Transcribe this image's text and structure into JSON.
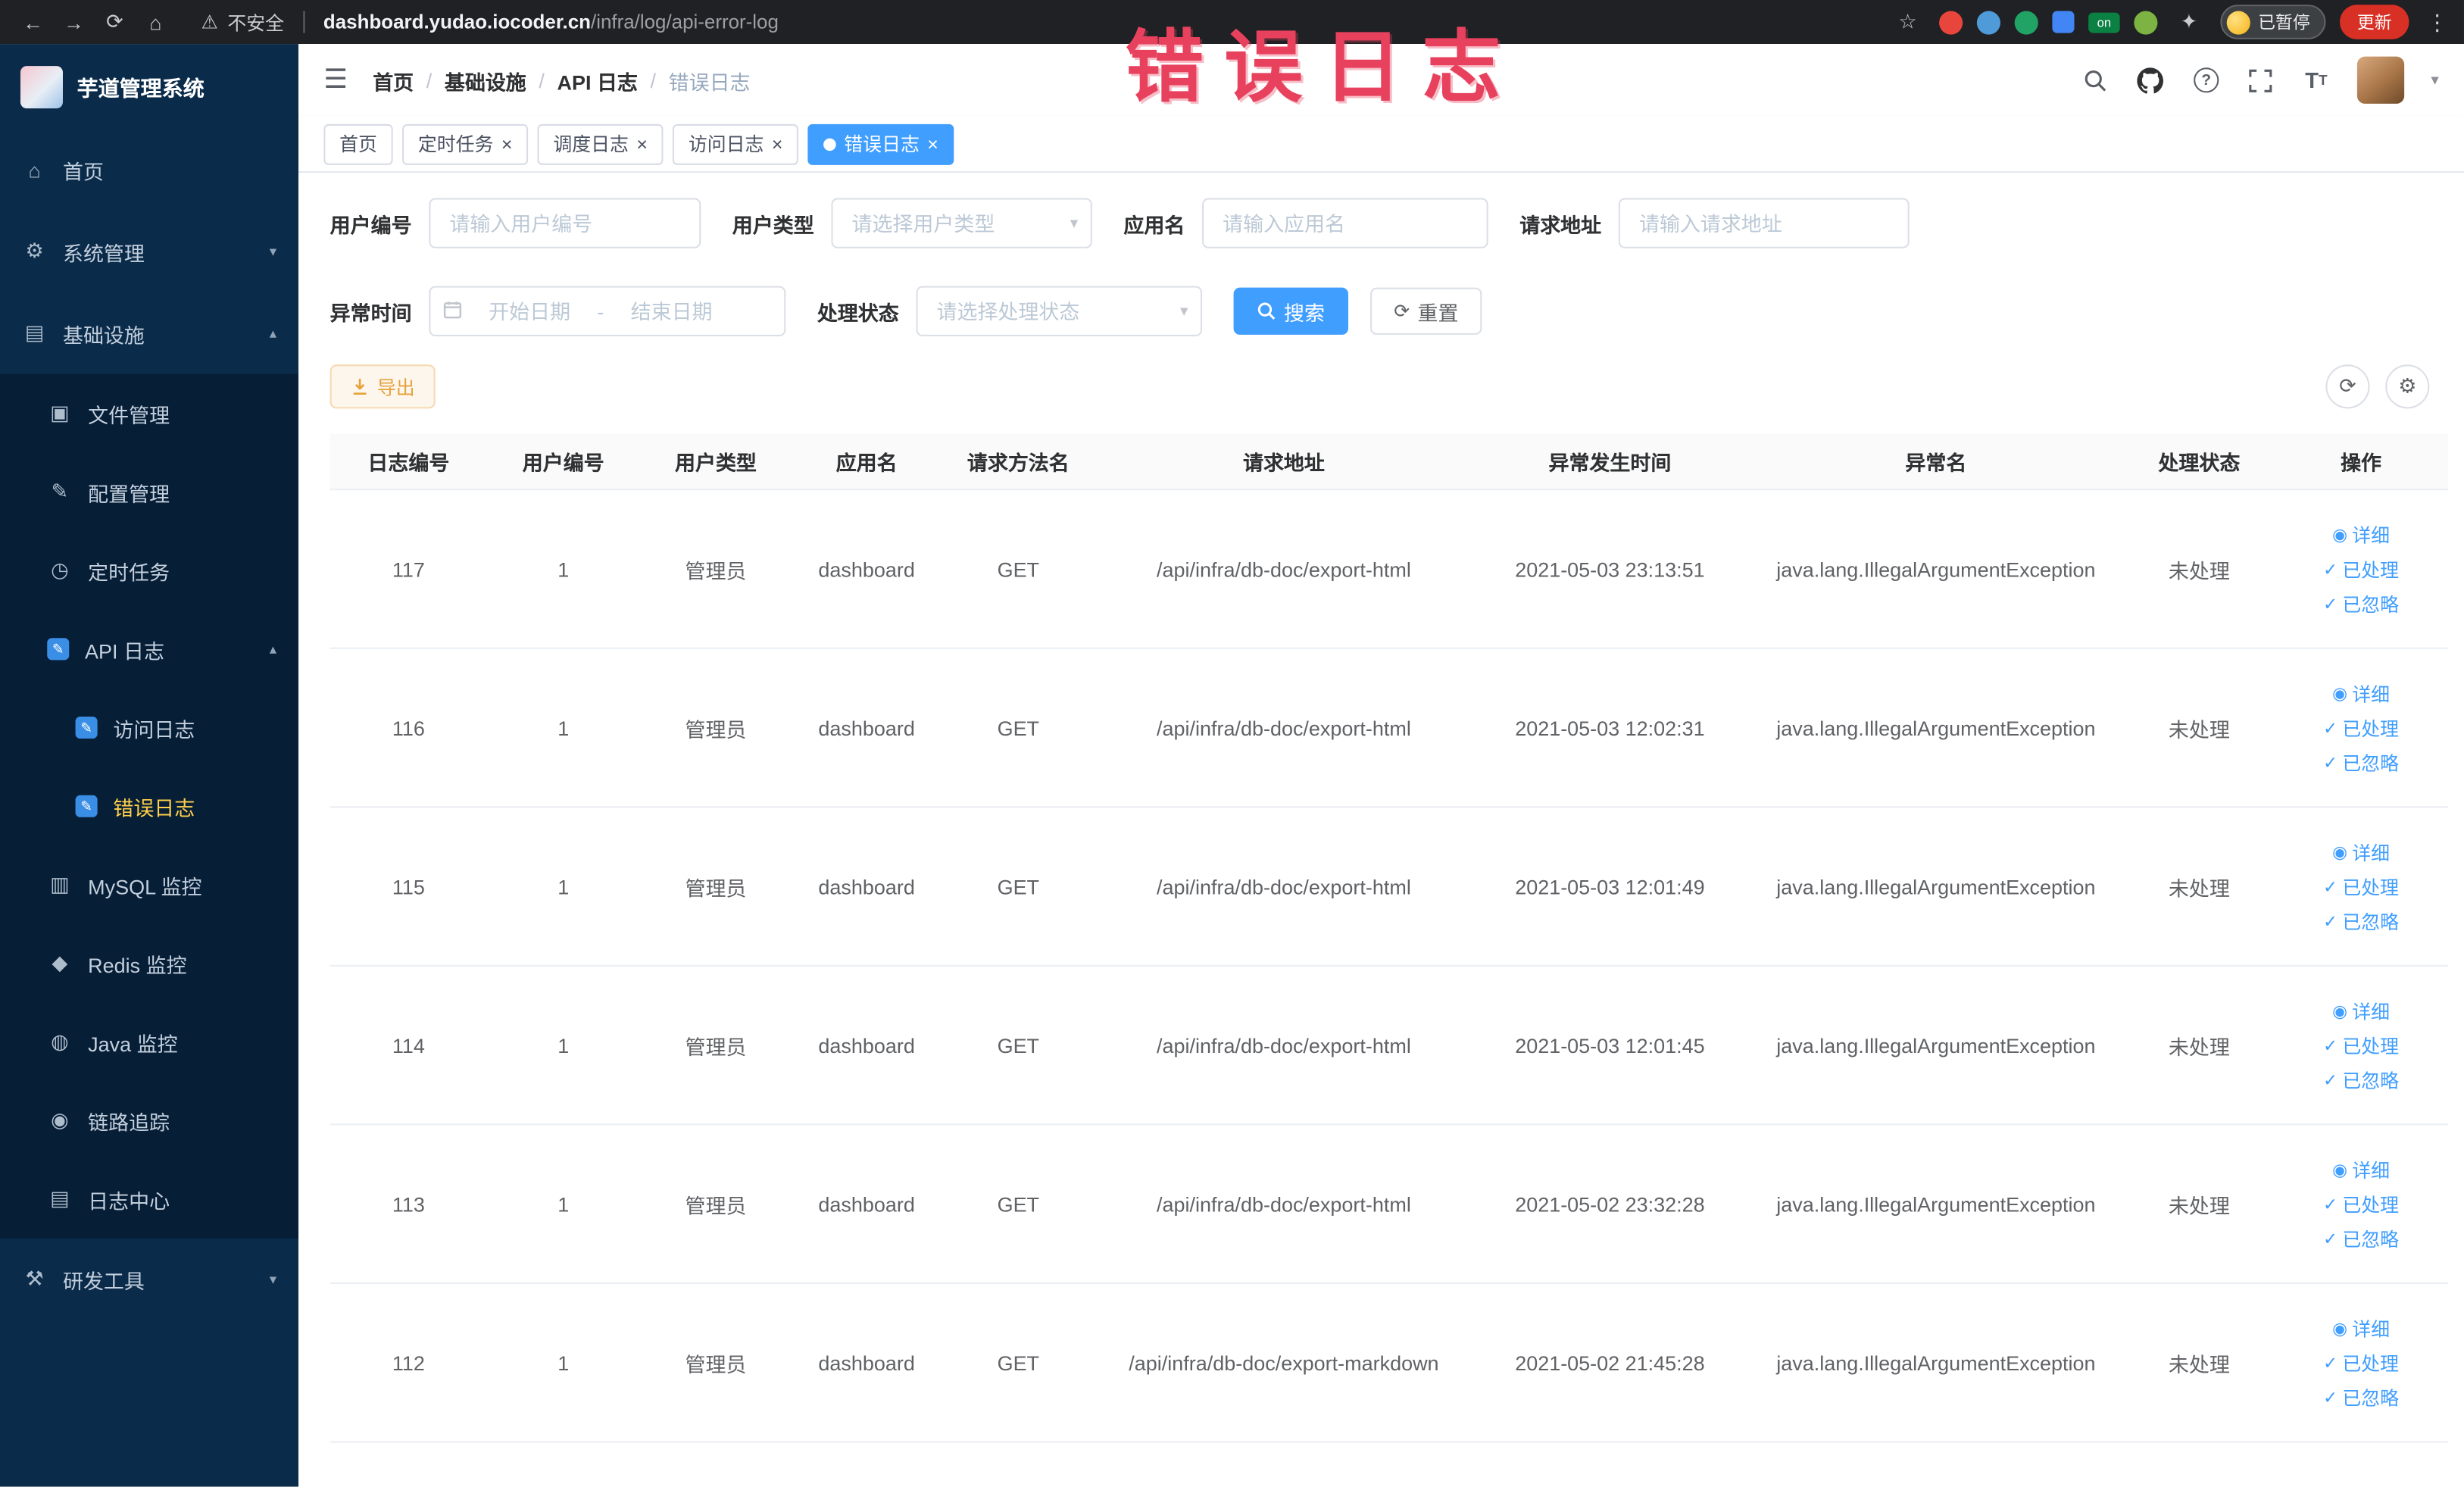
{
  "browser": {
    "security_label": "不安全",
    "url_domain": "dashboard.yudao.iocoder.cn",
    "url_path": "/infra/log/api-error-log",
    "extension_on_badge": "on",
    "paused_badge": "已暂停",
    "update_button": "更新"
  },
  "annotation": {
    "text": "错误日志",
    "color": "#e8415e"
  },
  "sidebar": {
    "title": "芋道管理系统",
    "menu": [
      {
        "label": "首页",
        "icon": "home-icon"
      },
      {
        "label": "系统管理",
        "icon": "gear-icon",
        "chevron": "down"
      },
      {
        "label": "基础设施",
        "icon": "infra-icon",
        "chevron": "up"
      },
      {
        "label": "文件管理",
        "icon": "file-icon"
      },
      {
        "label": "配置管理",
        "icon": "config-icon"
      },
      {
        "label": "定时任务",
        "icon": "timer-icon"
      },
      {
        "label": "API 日志",
        "icon": "api-log-icon",
        "chevron": "up"
      },
      {
        "label": "访问日志",
        "icon": "access-log-icon"
      },
      {
        "label": "错误日志",
        "icon": "error-log-icon",
        "active": true
      },
      {
        "label": "MySQL 监控",
        "icon": "mysql-icon"
      },
      {
        "label": "Redis 监控",
        "icon": "redis-icon"
      },
      {
        "label": "Java 监控",
        "icon": "java-icon"
      },
      {
        "label": "链路追踪",
        "icon": "trace-icon"
      },
      {
        "label": "日志中心",
        "icon": "log-center-icon"
      },
      {
        "label": "研发工具",
        "icon": "tools-icon",
        "chevron": "down"
      }
    ]
  },
  "topbar": {
    "breadcrumb": [
      "首页",
      "基础设施",
      "API 日志",
      "错误日志"
    ],
    "breadcrumb_separator": "/"
  },
  "tabbar": {
    "tabs": [
      {
        "label": "首页",
        "closable": false,
        "active": false
      },
      {
        "label": "定时任务",
        "closable": true,
        "active": false
      },
      {
        "label": "调度日志",
        "closable": true,
        "active": false
      },
      {
        "label": "访问日志",
        "closable": true,
        "active": false
      },
      {
        "label": "错误日志",
        "closable": true,
        "active": true
      }
    ]
  },
  "filters": {
    "user_id": {
      "label": "用户编号",
      "placeholder": "请输入用户编号"
    },
    "user_type": {
      "label": "用户类型",
      "placeholder": "请选择用户类型"
    },
    "app_name": {
      "label": "应用名",
      "placeholder": "请输入应用名"
    },
    "request_url": {
      "label": "请求地址",
      "placeholder": "请输入请求地址"
    },
    "exception_time": {
      "label": "异常时间",
      "start_placeholder": "开始日期",
      "separator": "-",
      "end_placeholder": "结束日期"
    },
    "process_status": {
      "label": "处理状态",
      "placeholder": "请选择处理状态"
    },
    "search_button": "搜索",
    "reset_button": "重置"
  },
  "toolbar": {
    "export_button": "导出"
  },
  "table": {
    "columns": [
      "日志编号",
      "用户编号",
      "用户类型",
      "应用名",
      "请求方法名",
      "请求地址",
      "异常发生时间",
      "异常名",
      "处理状态",
      "操作"
    ],
    "actions": {
      "detail": "详细",
      "processed": "已处理",
      "ignored": "已忽略"
    },
    "rows": [
      {
        "id": "117",
        "user_id": "1",
        "user_type": "管理员",
        "app": "dashboard",
        "method": "GET",
        "url": "/api/infra/db-doc/export-html",
        "time": "2021-05-03 23:13:51",
        "exception": "java.lang.IllegalArgumentException",
        "status": "未处理"
      },
      {
        "id": "116",
        "user_id": "1",
        "user_type": "管理员",
        "app": "dashboard",
        "method": "GET",
        "url": "/api/infra/db-doc/export-html",
        "time": "2021-05-03 12:02:31",
        "exception": "java.lang.IllegalArgumentException",
        "status": "未处理"
      },
      {
        "id": "115",
        "user_id": "1",
        "user_type": "管理员",
        "app": "dashboard",
        "method": "GET",
        "url": "/api/infra/db-doc/export-html",
        "time": "2021-05-03 12:01:49",
        "exception": "java.lang.IllegalArgumentException",
        "status": "未处理"
      },
      {
        "id": "114",
        "user_id": "1",
        "user_type": "管理员",
        "app": "dashboard",
        "method": "GET",
        "url": "/api/infra/db-doc/export-html",
        "time": "2021-05-03 12:01:45",
        "exception": "java.lang.IllegalArgumentException",
        "status": "未处理"
      },
      {
        "id": "113",
        "user_id": "1",
        "user_type": "管理员",
        "app": "dashboard",
        "method": "GET",
        "url": "/api/infra/db-doc/export-html",
        "time": "2021-05-02 23:32:28",
        "exception": "java.lang.IllegalArgumentException",
        "status": "未处理"
      },
      {
        "id": "112",
        "user_id": "1",
        "user_type": "管理员",
        "app": "dashboard",
        "method": "GET",
        "url": "/api/infra/db-doc/export-markdown",
        "time": "2021-05-02 21:45:28",
        "exception": "java.lang.IllegalArgumentException",
        "status": "未处理"
      }
    ]
  }
}
